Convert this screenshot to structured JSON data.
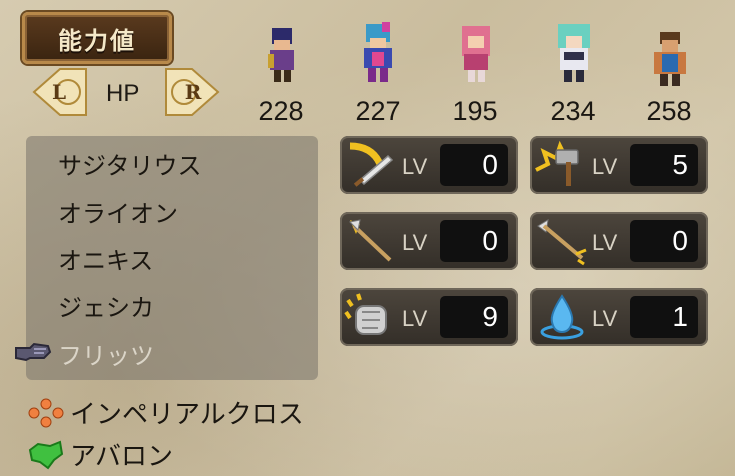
{
  "title": "能力値",
  "nav": {
    "left_label": "L",
    "right_label": "R",
    "stat_name": "HP"
  },
  "party": [
    {
      "name": "サジタリウス",
      "hp": "228"
    },
    {
      "name": "オライオン",
      "hp": "227"
    },
    {
      "name": "オニキス",
      "hp": "195"
    },
    {
      "name": "ジェシカ",
      "hp": "234"
    },
    {
      "name": "フリッツ",
      "hp": "258"
    }
  ],
  "lv_label": "LV",
  "skills": [
    {
      "icon": "sword-icon",
      "level": "0"
    },
    {
      "icon": "hammer-icon",
      "level": "5"
    },
    {
      "icon": "spear-icon",
      "level": "0"
    },
    {
      "icon": "bow-icon",
      "level": "0"
    },
    {
      "icon": "fist-icon",
      "level": "9"
    },
    {
      "icon": "water-drop-icon",
      "level": "1"
    }
  ],
  "footer": {
    "class_name": "インペリアルクロス",
    "location": "アバロン"
  },
  "colors": {
    "panel_dark": "#332e28",
    "accent_gold": "#e8b92a",
    "highlight_blue": "#3aa0e0"
  }
}
